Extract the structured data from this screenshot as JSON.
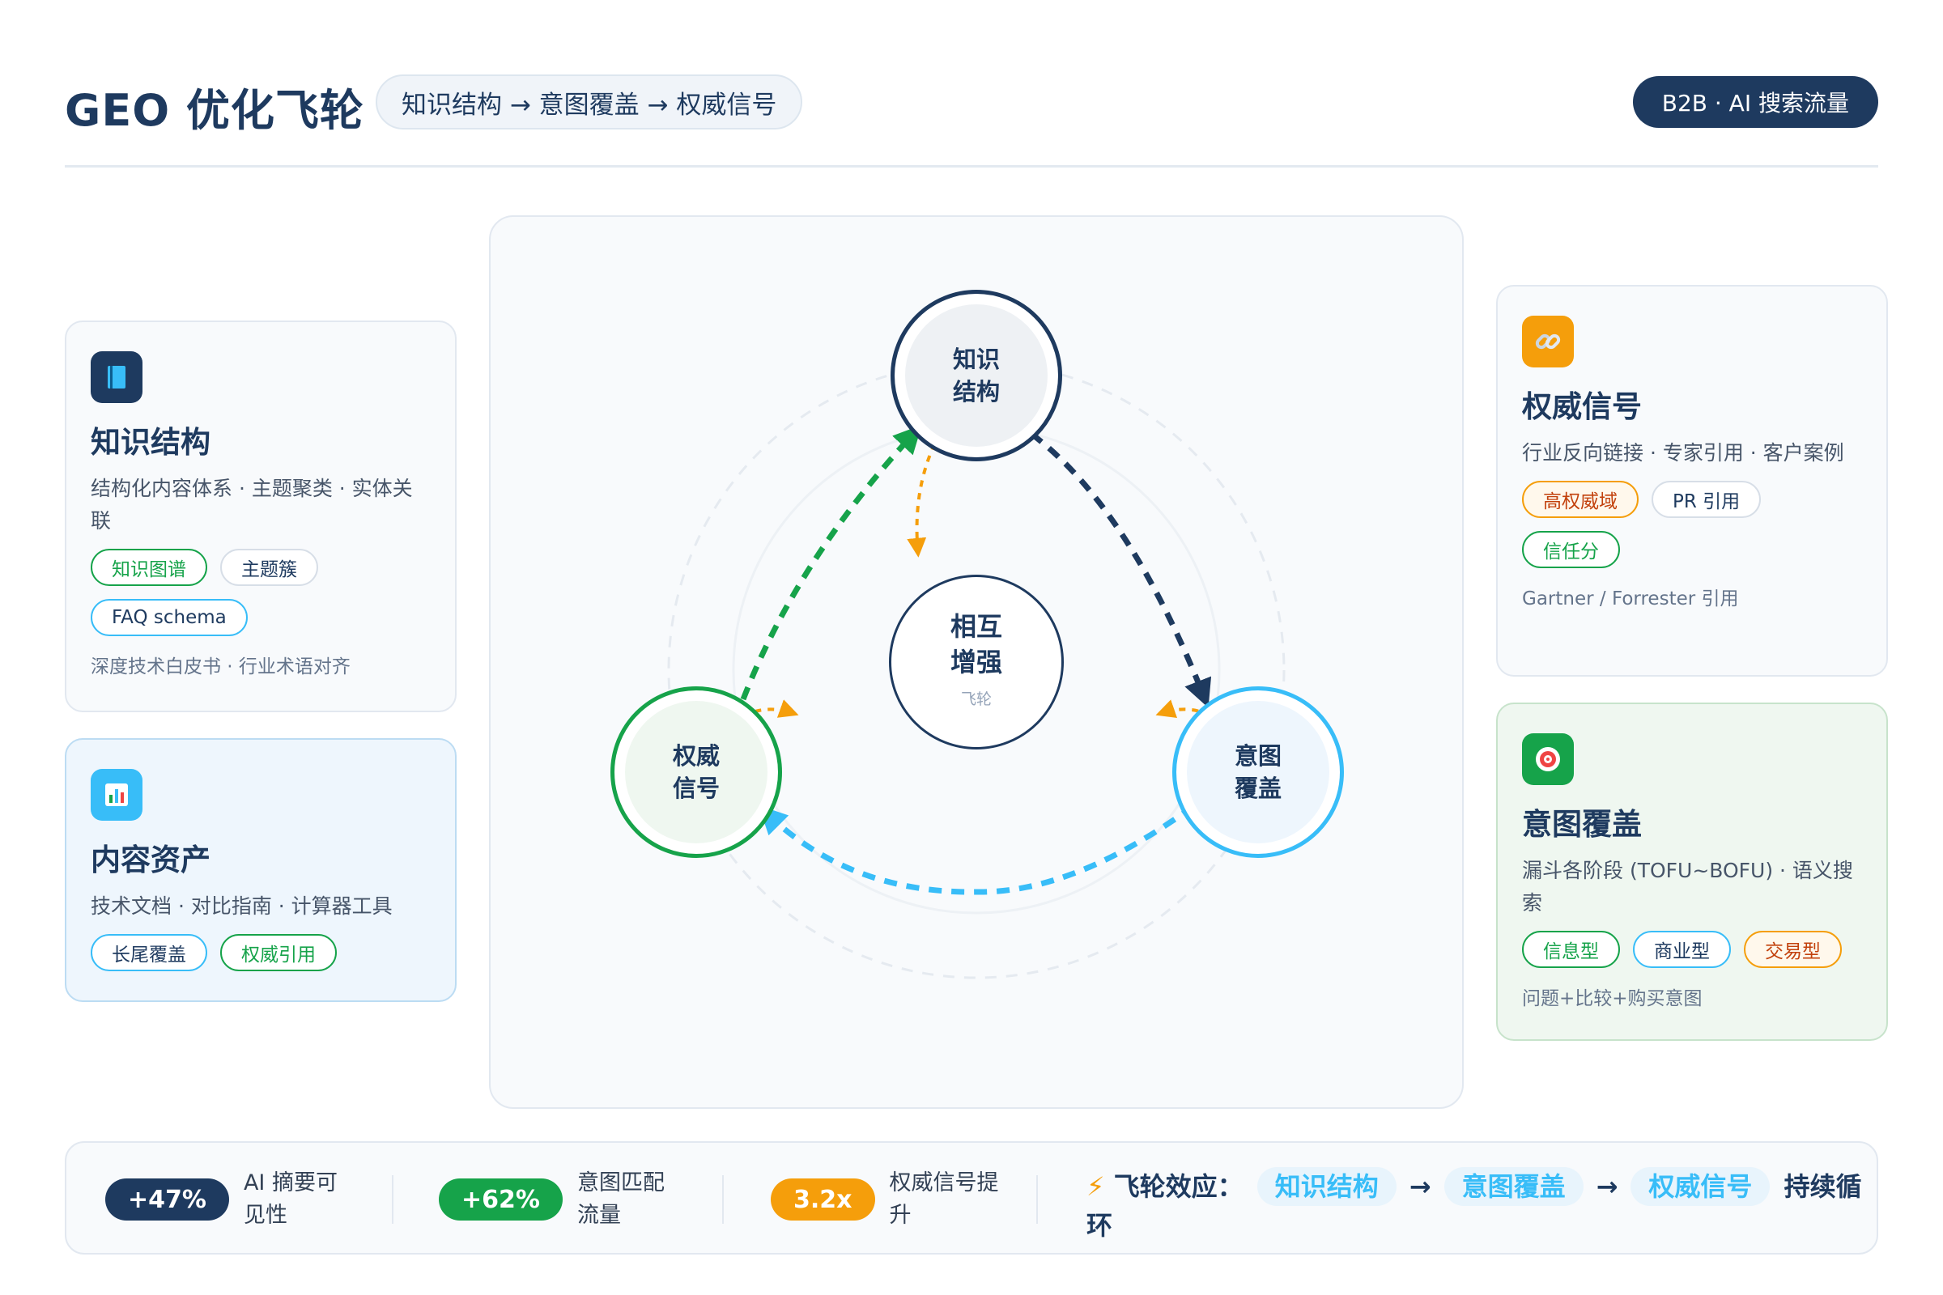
{
  "header": {
    "title": "GEO 优化飞轮",
    "subtitle": "知识结构 → 意图覆盖 → 权威信号",
    "badge": "B2B · AI 搜索流量"
  },
  "left_cards": [
    {
      "icon": "book-icon",
      "title": "知识结构",
      "desc": "结构化内容体系 · 主题聚类 · 实体关联",
      "tags": [
        "知识图谱",
        "主题簇",
        "FAQ schema"
      ],
      "foot": "深度技术白皮书 · 行业术语对齐"
    },
    {
      "icon": "bar-chart-icon",
      "title": "内容资产",
      "desc": "技术文档 · 对比指南 · 计算器工具",
      "tags": [
        "长尾覆盖",
        "权威引用"
      ]
    }
  ],
  "right_cards": [
    {
      "icon": "link-icon",
      "title": "权威信号",
      "desc": "行业反向链接 · 专家引用 · 客户案例",
      "tags": [
        "高权威域",
        "PR 引用",
        "信任分"
      ],
      "foot": "Gartner / Forrester 引用"
    },
    {
      "icon": "target-icon",
      "title": "意图覆盖",
      "desc": "漏斗各阶段 (TOFU~BOFU) · 语义搜索",
      "tags": [
        "信息型",
        "商业型",
        "交易型"
      ],
      "foot": "问题+比较+购买意图"
    }
  ],
  "diagram": {
    "node_top": [
      "知识",
      "结构"
    ],
    "node_left": [
      "权威",
      "信号"
    ],
    "node_right": [
      "意图",
      "覆盖"
    ],
    "center": [
      "相互",
      "增强"
    ],
    "center_sub": "飞轮"
  },
  "metrics": [
    {
      "value": "+47%",
      "label": [
        "AI 摘要可",
        "见性"
      ],
      "color": "#1e3a5f"
    },
    {
      "value": "+62%",
      "label": [
        "意图匹配",
        "流量"
      ],
      "color": "#16a34a"
    },
    {
      "value": "3.2x",
      "label": [
        "权威信号提",
        "升"
      ],
      "color": "#f59e0b"
    }
  ],
  "effect": {
    "icon": "lightning-icon",
    "lead": "飞轮效应：",
    "chips": [
      "知识结构",
      "意图覆盖",
      "权威信号"
    ],
    "arrow": "→",
    "tail": "持续循环"
  },
  "colors": {
    "navy": "#1e3a5f",
    "green": "#16a34a",
    "sky": "#38bdf8",
    "orange": "#f59e0b"
  }
}
